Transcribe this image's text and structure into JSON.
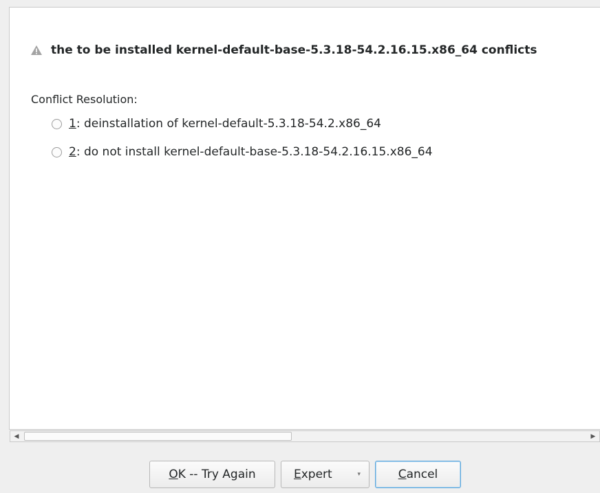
{
  "dialog": {
    "conflict_message": "the to be installed kernel-default-base-5.3.18-54.2.16.15.x86_64 conflicts",
    "section_label": "Conflict Resolution:",
    "options": [
      {
        "key": "1",
        "rest": ": deinstallation of kernel-default-5.3.18-54.2.x86_64",
        "selected": false
      },
      {
        "key": "2",
        "rest": ": do not install kernel-default-base-5.3.18-54.2.16.15.x86_64",
        "selected": false
      }
    ]
  },
  "scrollbar": {
    "left_arrow": "◀",
    "right_arrow": "▶"
  },
  "buttons": {
    "ok_mnemonic": "O",
    "ok_rest": "K -- Try Again",
    "expert_mnemonic": "E",
    "expert_rest": "xpert",
    "expert_arrow": "▾",
    "cancel_mnemonic": "C",
    "cancel_rest": "ancel"
  },
  "colors": {
    "warning_icon": "#9a9a9a",
    "focus_border": "#5fa8dc"
  }
}
